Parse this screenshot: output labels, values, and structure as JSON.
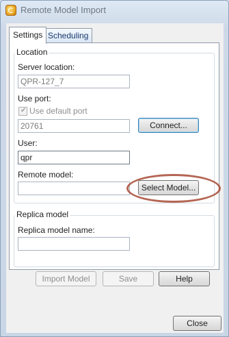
{
  "window": {
    "title": "Remote Model Import"
  },
  "tabs": [
    {
      "label": "Settings",
      "active": true
    },
    {
      "label": "Scheduling",
      "active": false
    }
  ],
  "location": {
    "group_label": "Location",
    "server_location_label": "Server location:",
    "server_location_value": "QPR-127_7",
    "use_port_label": "Use port:",
    "use_default_port_label": "Use default port",
    "use_default_port_checked": true,
    "port_value": "20761",
    "connect_label": "Connect...",
    "user_label": "User:",
    "user_value": "qpr",
    "remote_model_label": "Remote model:",
    "remote_model_value": "",
    "select_model_label": "Select Model..."
  },
  "replica": {
    "group_label": "Replica model",
    "name_label": "Replica model name:",
    "name_value": ""
  },
  "buttons": {
    "import_model": "Import Model",
    "save": "Save",
    "help": "Help",
    "close": "Close"
  },
  "colors": {
    "highlight_ellipse": "#a74a35",
    "focus_border": "#3c7fb1"
  }
}
